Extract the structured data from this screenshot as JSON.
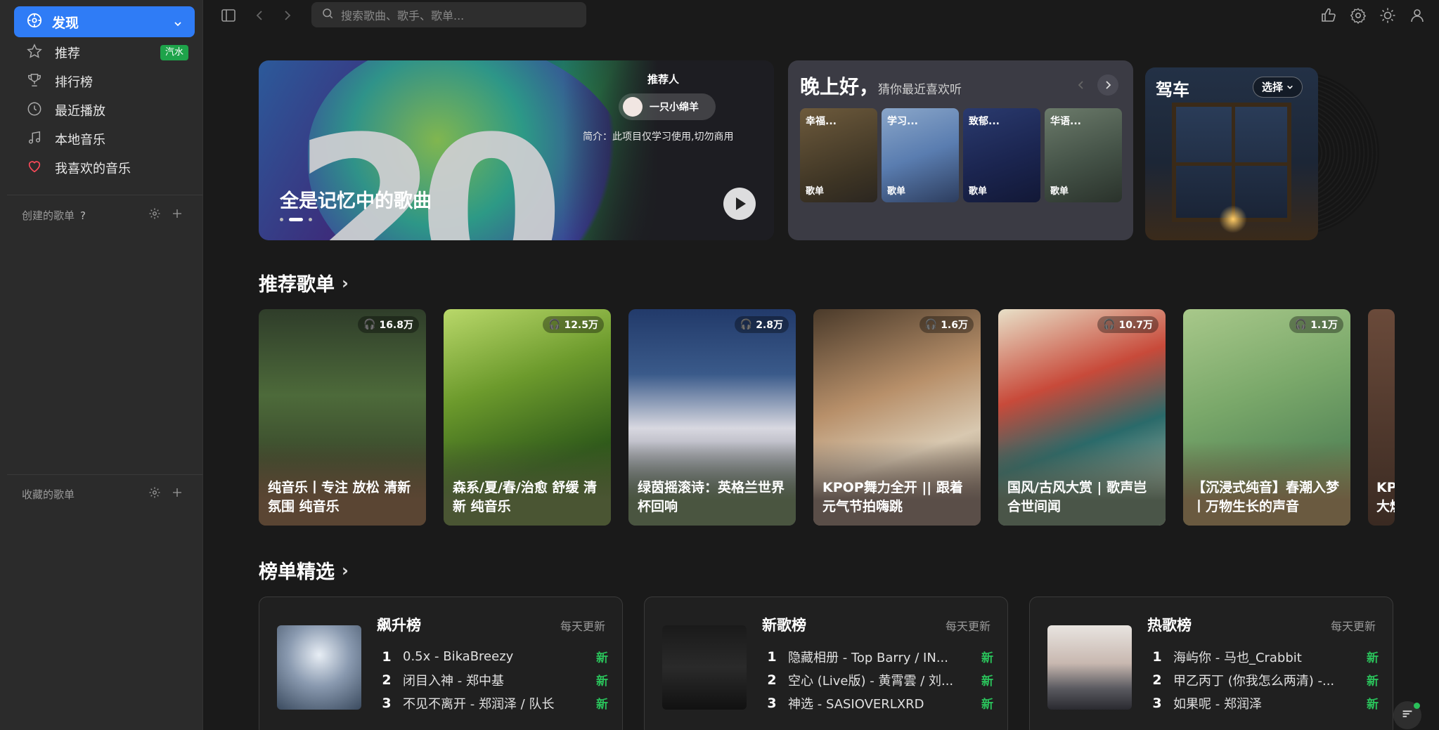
{
  "sidebar": {
    "active": {
      "label": "发现",
      "icon": "compass-icon"
    },
    "items": [
      {
        "label": "推荐",
        "icon": "star-icon",
        "badge": "汽水"
      },
      {
        "label": "排行榜",
        "icon": "trophy-icon"
      },
      {
        "label": "最近播放",
        "icon": "clock-icon"
      },
      {
        "label": "本地音乐",
        "icon": "music-note-icon"
      },
      {
        "label": "我喜欢的音乐",
        "icon": "heart-icon"
      }
    ],
    "created_playlists": {
      "title": "创建的歌单",
      "help": "?"
    },
    "collected_playlists": {
      "title": "收藏的歌单"
    }
  },
  "topbar": {
    "search_placeholder": "搜索歌曲、歌手、歌单..."
  },
  "banner": {
    "title": "全是记忆中的歌曲",
    "number_art": "20",
    "recommender_label": "推荐人",
    "recommender_name": "一只小绵羊",
    "intro": "简介：此项目仅学习使用,切勿商用"
  },
  "greeting": {
    "hello": "晚上好，",
    "sub": "猜你最近喜欢听",
    "tiles": [
      {
        "title": "幸福...",
        "type": "歌单"
      },
      {
        "title": "学习...",
        "type": "歌单"
      },
      {
        "title": "致郁...",
        "type": "歌单"
      },
      {
        "title": "华语...",
        "type": "歌单"
      }
    ]
  },
  "drive": {
    "title": "驾车",
    "select": "选择"
  },
  "recommend": {
    "heading": "推荐歌单",
    "items": [
      {
        "plays": "16.8万",
        "name": "纯音乐丨专注 放松 清新氛围 纯音乐"
      },
      {
        "plays": "12.5万",
        "name": "森系/夏/春/治愈 舒缓 清新 纯音乐"
      },
      {
        "plays": "2.8万",
        "name": "绿茵摇滚诗：英格兰世界杯回响"
      },
      {
        "plays": "1.6万",
        "name": "KPOP舞力全开 || 跟着元气节拍嗨跳"
      },
      {
        "plays": "10.7万",
        "name": "国风/古风大赏 | 歌声岂合世间闻"
      },
      {
        "plays": "1.1万",
        "name": "【沉浸式纯音】春潮入梦丨万物生长的声音"
      },
      {
        "plays": "",
        "name": "KPOP大燃"
      }
    ]
  },
  "charts": {
    "heading": "榜单精选",
    "items": [
      {
        "name": "飙升榜",
        "update": "每天更新",
        "songs": [
          {
            "idx": "1",
            "title": "0.5x - BikaBreezy",
            "tag": "新"
          },
          {
            "idx": "2",
            "title": "闭目入神 - 郑中基",
            "tag": "新"
          },
          {
            "idx": "3",
            "title": "不见不离开 - 郑润泽 / 队长",
            "tag": "新"
          }
        ]
      },
      {
        "name": "新歌榜",
        "update": "每天更新",
        "songs": [
          {
            "idx": "1",
            "title": "隐藏相册 - Top Barry / IN...",
            "tag": "新"
          },
          {
            "idx": "2",
            "title": "空心 (Live版) - 黄霄雲 / 刘...",
            "tag": "新"
          },
          {
            "idx": "3",
            "title": "神选 - SASIOVERLXRD",
            "tag": "新"
          }
        ]
      },
      {
        "name": "热歌榜",
        "update": "每天更新",
        "songs": [
          {
            "idx": "1",
            "title": "海屿你 - 马也_Crabbit",
            "tag": "新"
          },
          {
            "idx": "2",
            "title": "甲乙丙丁 (你我怎么两清) -...",
            "tag": "新"
          },
          {
            "idx": "3",
            "title": "如果呢 - 郑润泽",
            "tag": "新"
          }
        ]
      }
    ]
  },
  "colors": {
    "accent": "#2f7cf6",
    "badge_green": "#1ea34a",
    "new_green": "#2ac05a"
  }
}
